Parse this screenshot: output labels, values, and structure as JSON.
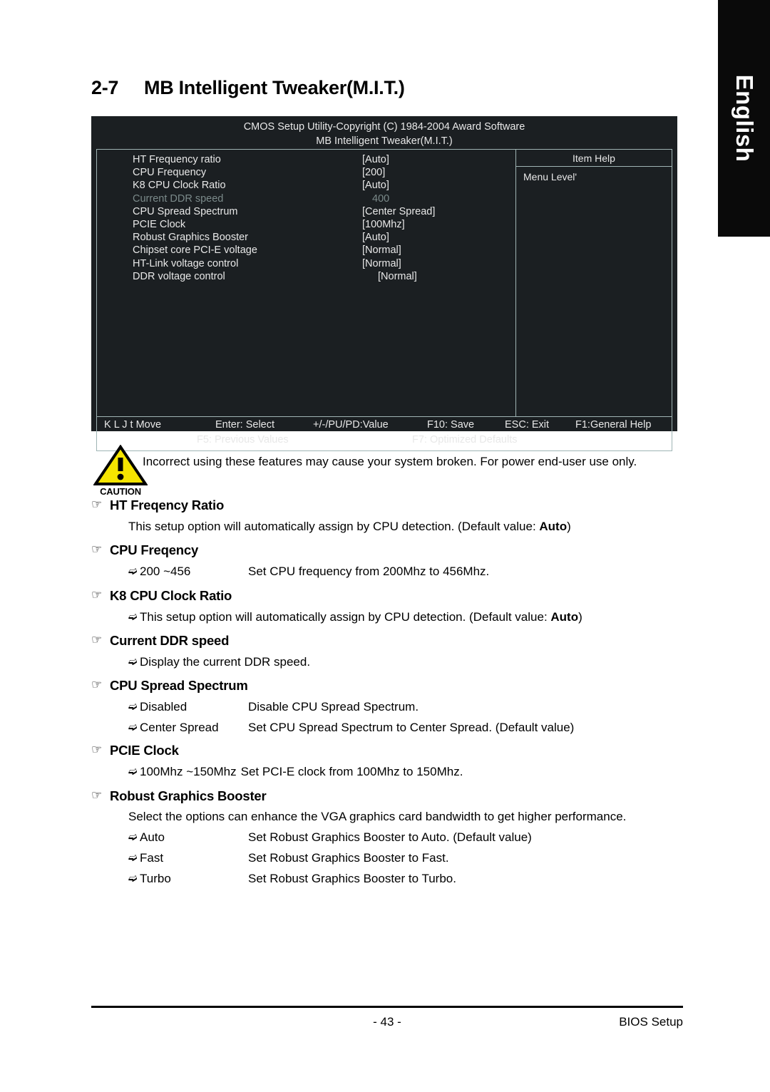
{
  "language_tab": {
    "label": "English"
  },
  "chapter": {
    "number": "2-7",
    "title": "MB Intelligent Tweaker(M.I.T.)"
  },
  "bios": {
    "title_line1": "CMOS Setup Utility-Copyright (C) 1984-2004 Award Software",
    "title_line2": "MB Intelligent Tweaker(M.I.T.)",
    "help_title": "Item Help",
    "help_line": "Menu Level'",
    "items": [
      {
        "name": "HT Frequency ratio",
        "value": "[Auto]",
        "dim": false
      },
      {
        "name": "CPU Frequency",
        "value": "[200]",
        "dim": false
      },
      {
        "name": "K8 CPU Clock Ratio",
        "value": "[Auto]",
        "dim": false
      },
      {
        "name": "Current DDR speed",
        "value": "400",
        "dim": true
      },
      {
        "name": "CPU Spread Spectrum",
        "value": "[Center Spread]",
        "dim": false
      },
      {
        "name": "PCIE Clock",
        "value": "[100Mhz]",
        "dim": false
      },
      {
        "name": "Robust Graphics Booster",
        "value": "[Auto]",
        "dim": false
      },
      {
        "name": "Chipset core PCI-E voltage",
        "value": "[Normal]",
        "dim": false
      },
      {
        "name": "HT-Link voltage control",
        "value": "[Normal]",
        "dim": false
      },
      {
        "name": "DDR voltage control",
        "value": "[Normal]",
        "dim": false
      }
    ],
    "nav": {
      "move": "K L J t Move",
      "enter": "Enter: Select",
      "value": "+/-/PU/PD:Value",
      "f10": "F10: Save",
      "esc": "ESC: Exit",
      "f1": "F1:General Help",
      "f5": "F5: Previous Values",
      "f7": "F7: Optimized Defaults"
    }
  },
  "caution": {
    "word": "CAUTION",
    "text": "Incorrect using these features may cause your system broken. For power end-user use only."
  },
  "sections": [
    {
      "heading": "HT Freqency Ratio",
      "paragraph_prefix": "This setup option will automatically assign by CPU detection. (Default value: ",
      "paragraph_bold": "Auto",
      "paragraph_suffix": ")"
    },
    {
      "heading": "CPU Freqency",
      "bullets": [
        {
          "label": "200 ~456",
          "desc": "Set CPU  frequency from 200Mhz to 456Mhz."
        }
      ]
    },
    {
      "heading": "K8 CPU Clock Ratio",
      "bullet_prefix": "This setup option will automatically assign by CPU detection. (Default value: ",
      "bullet_bold": "Auto",
      "bullet_suffix": ")"
    },
    {
      "heading": "Current DDR speed",
      "bullets": [
        {
          "label": "Display the current DDR speed.",
          "desc": ""
        }
      ]
    },
    {
      "heading": "CPU Spread Spectrum",
      "bullets": [
        {
          "label": "Disabled",
          "desc": "Disable CPU Spread Spectrum."
        },
        {
          "label": "Center Spread",
          "desc": "Set CPU Spread Spectrum to Center Spread. (Default value)"
        }
      ]
    },
    {
      "heading": "PCIE Clock",
      "bullets": [
        {
          "label": "100Mhz ~150Mhz",
          "desc": "Set PCI-E  clock from 100Mhz to 150Mhz."
        }
      ]
    },
    {
      "heading": "Robust Graphics Booster",
      "paragraph": "Select the options can enhance the VGA graphics card bandwidth to get higher performance.",
      "bullets": [
        {
          "label": "Auto",
          "desc": "Set Robust Graphics Booster to Auto. (Default value)"
        },
        {
          "label": "Fast",
          "desc": "Set Robust Graphics Booster to Fast."
        },
        {
          "label": "Turbo",
          "desc": "Set Robust Graphics Booster to Turbo."
        }
      ]
    }
  ],
  "footer": {
    "page_number": "- 43 -",
    "right_label": "BIOS Setup"
  }
}
